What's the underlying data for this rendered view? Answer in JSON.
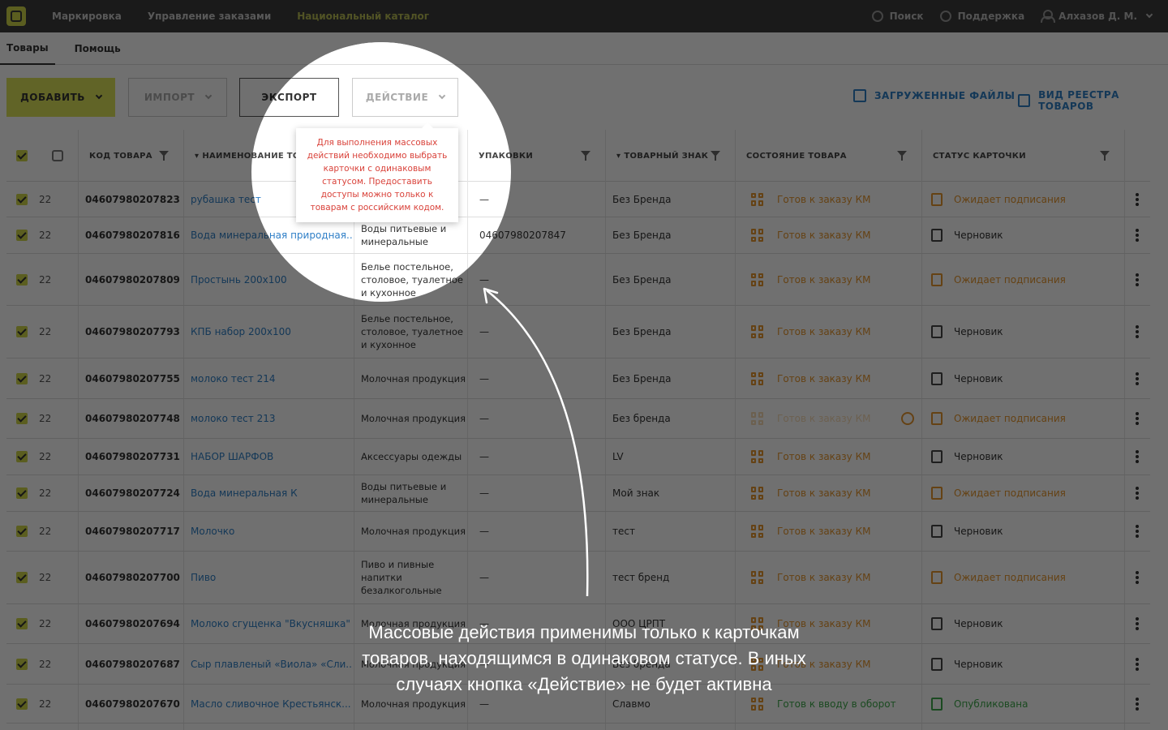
{
  "topbar": {
    "nav": [
      "Маркировка",
      "Управление заказами",
      "Национальный каталог"
    ],
    "search": "Поиск",
    "support": "Поддержка",
    "user": "Алхазов Д. М."
  },
  "subtabs": [
    "Товары",
    "Помощь"
  ],
  "toolbar": {
    "add": "ДОБАВИТЬ",
    "import": "ИМПОРТ",
    "export": "ЭКСПОРТ",
    "action": "ДЕЙСТВИЕ",
    "uploaded": "ЗАГРУЖЕННЫЕ ФАЙЛЫ",
    "registry_view": "ВИД РЕЕСТРА ТОВАРОВ"
  },
  "columns": {
    "code": "КОД ТОВАРА",
    "name": "НАИМЕНОВАНИЕ ТОВАРА",
    "packs": "УПАКОВКИ",
    "brand": "ТОВАРНЫЙ ЗНАК",
    "state": "СОСТОЯНИЕ ТОВАРА",
    "card_status": "СТАТУС КАРТОЧКИ"
  },
  "rows": [
    {
      "date": "22",
      "code": "04607980207823",
      "name": "рубашка тест",
      "category": "",
      "pack": "—",
      "brand": "Без Бренда",
      "state": "Готов к заказу КМ",
      "card": "Ожидает подписания"
    },
    {
      "date": "22",
      "code": "04607980207816",
      "name": "Вода минеральная природная...",
      "category": "Воды питьевые и минеральные",
      "pack": "04607980207847",
      "brand": "Без Бренда",
      "state": "Готов к заказу КМ",
      "card": "Черновик"
    },
    {
      "date": "22",
      "code": "04607980207809",
      "name": "Простынь 200х100",
      "category": "Белье постельное, столовое, туалетное и кухонное",
      "pack": "—",
      "brand": "Без Бренда",
      "state": "Готов к заказу КМ",
      "card": "Ожидает подписания"
    },
    {
      "date": "22",
      "code": "04607980207793",
      "name": "КПБ набор 200х100",
      "category": "Белье постельное, столовое, туалетное и кухонное",
      "pack": "—",
      "brand": "Без Бренда",
      "state": "Готов к заказу КМ",
      "card": "Черновик"
    },
    {
      "date": "22",
      "code": "04607980207755",
      "name": "молоко тест 214",
      "category": "Молочная продукция",
      "pack": "—",
      "brand": "Без Бренда",
      "state": "Готов к заказу КМ",
      "card": "Черновик"
    },
    {
      "date": "22",
      "code": "04607980207748",
      "name": "молоко тест 213",
      "category": "Молочная продукция",
      "pack": "—",
      "brand": "Без бренда",
      "state": "Готов к заказу КМ",
      "card": "Ожидает подписания"
    },
    {
      "date": "22",
      "code": "04607980207731",
      "name": "НАБОР ШАРФОВ",
      "category": "Аксессуары одежды",
      "pack": "—",
      "brand": "LV",
      "state": "Готов к заказу КМ",
      "card": "Черновик"
    },
    {
      "date": "22",
      "code": "04607980207724",
      "name": "Вода минеральная К",
      "category": "Воды питьевые и минеральные",
      "pack": "—",
      "brand": "Мой знак",
      "state": "Готов к заказу КМ",
      "card": "Ожидает подписания"
    },
    {
      "date": "22",
      "code": "04607980207717",
      "name": "Молочко",
      "category": "Молочная продукция",
      "pack": "—",
      "brand": "тест",
      "state": "Готов к заказу КМ",
      "card": "Черновик"
    },
    {
      "date": "22",
      "code": "04607980207700",
      "name": "Пиво",
      "category": "Пиво и пивные напитки безалкогольные",
      "pack": "—",
      "brand": "тест бренд",
      "state": "Готов к заказу КМ",
      "card": "Ожидает подписания"
    },
    {
      "date": "22",
      "code": "04607980207694",
      "name": "Молоко сгущенка \"Вкусняшка\"",
      "category": "Молочная продукция",
      "pack": "—",
      "brand": "ООО ЦРПТ",
      "state": "Готов к заказу КМ",
      "card": "Черновик"
    },
    {
      "date": "22",
      "code": "04607980207687",
      "name": "Сыр плавленый «Виола» «Сли...",
      "category": "Молочная продукция",
      "pack": "—",
      "brand": "Без бренда",
      "state": "Готов к заказу КМ",
      "card": "Черновик"
    },
    {
      "date": "22",
      "code": "04607980207670",
      "name": "Масло сливочное Крестьянск...",
      "category": "Молочная продукция",
      "pack": "—",
      "brand": "Славмо",
      "state": "Готов к вводу в оборот",
      "card": "Опубликована"
    }
  ],
  "tooltip": "Для выполнения массовых действий необходимо выбрать карточки с одинаковым статусом. Предоставить доступы можно только к товарам с российским кодом.",
  "caption": "Массовые действия применимы только к карточкам товаров, находящимся в одинаковом статусе. В иных случаях кнопка «Действие» не будет активна",
  "colors": {
    "accent": "#dce35a",
    "link": "#2f7fc7",
    "orange": "#e6962e",
    "green": "#3ea94b",
    "error": "#d9423a"
  }
}
